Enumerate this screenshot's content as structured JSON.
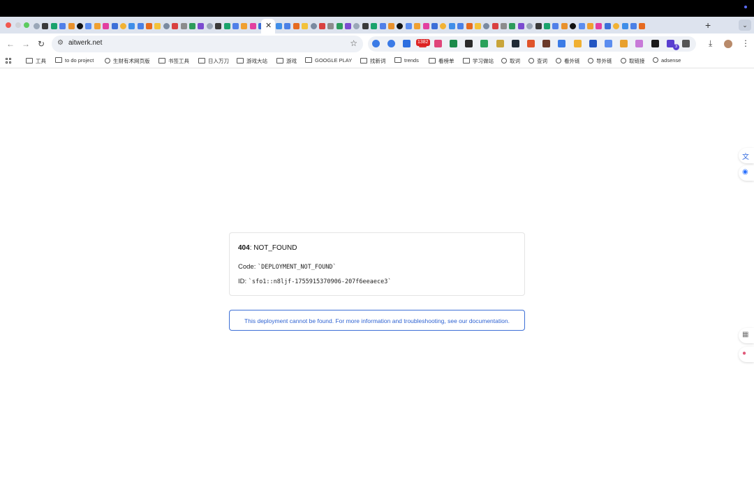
{
  "browser": {
    "active_tab_close": "✕",
    "new_tab": "+",
    "tab_menu": "⌄",
    "url": "aitwerk.net",
    "extension_badge": "1382",
    "extension_count_badge": "3"
  },
  "bookmarks": [
    {
      "label": "工具",
      "icon": "folder-icon"
    },
    {
      "label": "to do project",
      "icon": "folder-icon"
    },
    {
      "label": "生财有术网页版",
      "icon": "globe-icon"
    },
    {
      "label": "书签工具",
      "icon": "folder-icon"
    },
    {
      "label": "日入万刀",
      "icon": "folder-icon"
    },
    {
      "label": "游戏大站",
      "icon": "folder-icon"
    },
    {
      "label": "游戏",
      "icon": "folder-icon"
    },
    {
      "label": "GOOGLE PLAY",
      "icon": "folder-icon"
    },
    {
      "label": "找新词",
      "icon": "folder-icon"
    },
    {
      "label": "trends",
      "icon": "folder-icon"
    },
    {
      "label": "看榜单",
      "icon": "folder-icon"
    },
    {
      "label": "学习做站",
      "icon": "folder-icon"
    },
    {
      "label": "取词",
      "icon": "globe-icon"
    },
    {
      "label": "查词",
      "icon": "globe-icon"
    },
    {
      "label": "看外链",
      "icon": "globe-icon"
    },
    {
      "label": "导外链",
      "icon": "globe-icon"
    },
    {
      "label": "取链接",
      "icon": "globe-icon"
    },
    {
      "label": "adsense",
      "icon": "globe-icon"
    }
  ],
  "error": {
    "code_number": "404",
    "code_text": ": NOT_FOUND",
    "code_label": "Code: ",
    "code_value": "`DEPLOYMENT_NOT_FOUND`",
    "id_label": "ID: ",
    "id_value": "`sfo1::n8ljf-1755915370906-207f6eeaece3`"
  },
  "info": {
    "message": "This deployment cannot be found. For more information and troubleshooting, see our documentation."
  },
  "colors": {
    "link_blue": "#2f63d2",
    "tab_strip": "#dde3ee",
    "omnibox": "#eef1f6"
  }
}
